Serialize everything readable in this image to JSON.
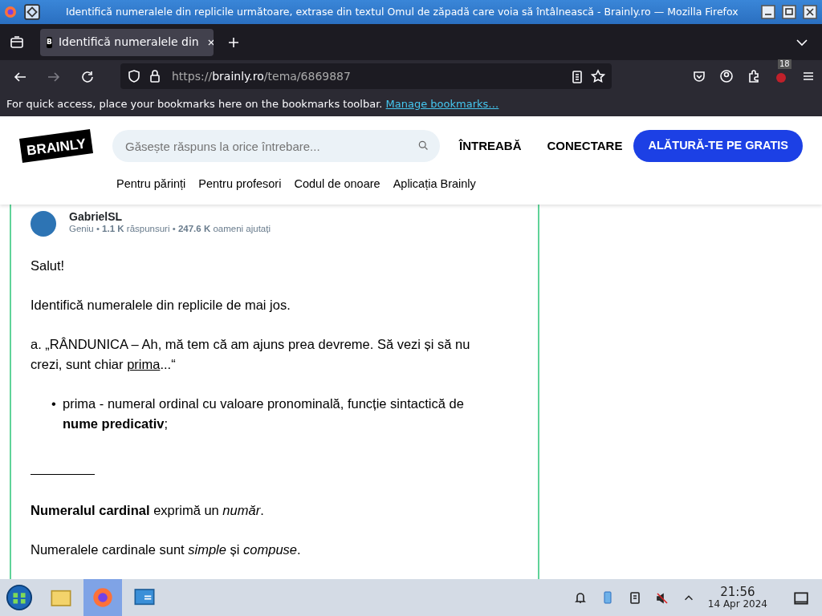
{
  "window": {
    "title": "Identifică numeralele din replicile următoare, extrase din textul Omul de zăpadă care voia să întâlnească - Brainly.ro — Mozilla Firefox"
  },
  "tabs": [
    {
      "label": "Identifică numeralele din",
      "selected": true,
      "favicon": "B"
    }
  ],
  "address_bar": {
    "scheme": "https://",
    "host": "brainly.ro",
    "path": "/tema/6869887"
  },
  "extension_badge": "18",
  "bookmarks_bar": {
    "message": "For quick access, place your bookmarks here on the bookmarks toolbar.",
    "link": "Manage bookmarks…"
  },
  "site_header": {
    "logo": "BRAINLY",
    "search": {
      "placeholder": "Găsește răspuns la orice întrebare..."
    },
    "ask": "ÎNTREABĂ",
    "login": "CONECTARE",
    "join": "ALĂTURĂ-TE PE GRATIS",
    "links": [
      "Pentru părinți",
      "Pentru profesori",
      "Codul de onoare",
      "Aplicația Brainly"
    ]
  },
  "answer": {
    "author": "GabrielSL",
    "stats": "Geniu • **1.1 K** răspunsuri • **247.6 K** oameni ajutați",
    "content": [
      {
        "kind": "paragraph",
        "segments": [
          {
            "text": "Salut!",
            "underlined": false
          }
        ]
      },
      {
        "kind": "paragraph",
        "segments": [
          {
            "text": "Identifică numeralele din replicile de mai jos.",
            "underlined": false
          }
        ]
      },
      {
        "kind": "paragraph",
        "segments": [
          {
            "text": "a. „RÂNDUNICA – Ah, mă tem că am ajuns prea devreme. Să vezi și să nu crezi, sunt chiar ",
            "underlined": false
          },
          {
            "text": "prima",
            "underlined": true
          },
          {
            "text": "...“",
            "underlined": false
          }
        ]
      },
      {
        "kind": "bullet",
        "marker": "•",
        "segments": [
          {
            "text": "prima - numeral ordinal cu valoare pronominală, funcție sintactică de **nume predicativ**;",
            "underlined": false
          }
        ]
      },
      {
        "kind": "rule"
      },
      {
        "kind": "paragraph",
        "segments": [
          {
            "text": "**Numeralul cardinal** exprimă un *număr*.",
            "underlined": false
          }
        ]
      },
      {
        "kind": "paragraph",
        "segments": [
          {
            "text": "Numeralele cardinale sunt *simple* și *compuse*.",
            "underlined": false
          }
        ]
      }
    ]
  },
  "taskbar": {
    "time": "21:56",
    "date": "14 Apr 2024",
    "apps": [
      {
        "kind": "folder",
        "selected": false
      },
      {
        "kind": "browser",
        "selected": true
      },
      {
        "kind": "panel",
        "selected": false
      }
    ],
    "sound_muted": true
  }
}
